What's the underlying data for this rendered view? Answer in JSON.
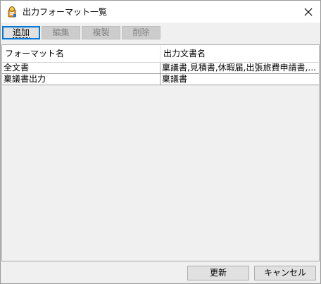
{
  "window": {
    "title": "出力フォーマット一覧",
    "icon": "app-document-icon",
    "close_icon": "close-icon"
  },
  "toolbar": {
    "add_label": "追加",
    "edit_label": "編集",
    "duplicate_label": "複製",
    "delete_label": "削除"
  },
  "grid": {
    "columns": [
      "フォーマット名",
      "出力文書名"
    ],
    "rows": [
      [
        "全文書",
        "稟議書,見積書,休暇届,出張旅費申請書,経…"
      ],
      [
        "稟議書出力",
        "稟議書"
      ]
    ]
  },
  "footer": {
    "refresh_label": "更新",
    "cancel_label": "キャンセル"
  },
  "colors": {
    "accent_focus": "#0078d7",
    "button_face": "#e1e1e1",
    "disabled_button": "#cccccc",
    "disabled_text": "#838383",
    "window_bg": "#f0f0f0"
  }
}
